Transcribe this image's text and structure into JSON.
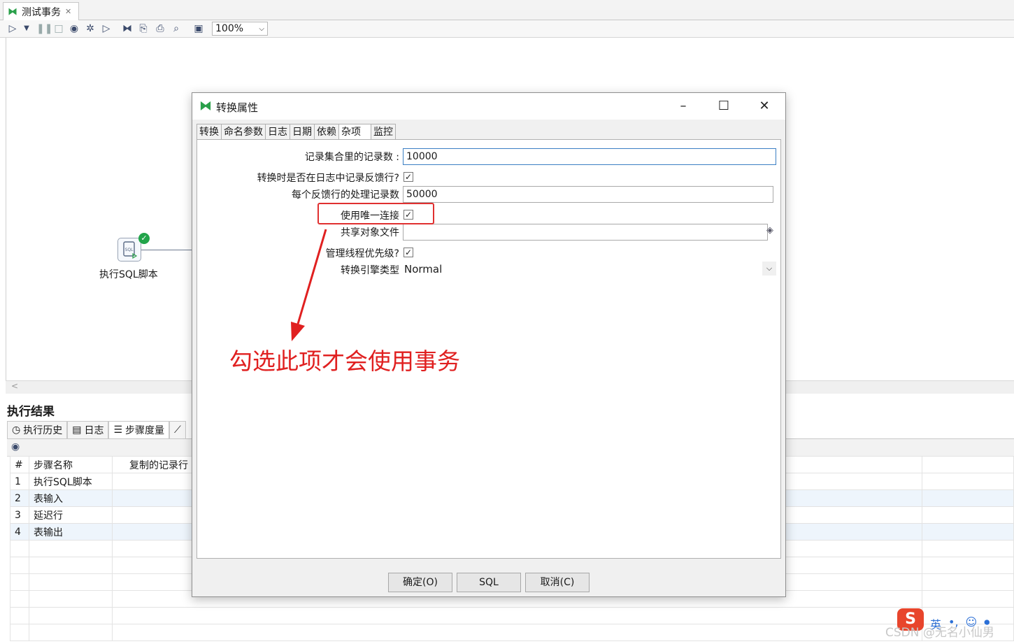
{
  "document_tab": {
    "title": "测试事务",
    "close": "✕"
  },
  "toolbar": {
    "zoom": "100%"
  },
  "canvas": {
    "step_name": "执行SQL脚本",
    "step_icon_text": "SQL"
  },
  "results": {
    "title": "执行结果",
    "tabs": [
      "执行历史",
      "日志",
      "步骤度量"
    ],
    "columns": [
      "#",
      "步骤名称",
      "复制的记录行"
    ],
    "rows": [
      {
        "num": "1",
        "name": "执行SQL脚本"
      },
      {
        "num": "2",
        "name": "表输入"
      },
      {
        "num": "3",
        "name": "延迟行"
      },
      {
        "num": "4",
        "name": "表输出"
      }
    ]
  },
  "dialog": {
    "title": "转换属性",
    "tabs": [
      "转换",
      "命名参数",
      "日志",
      "日期",
      "依赖",
      "杂项",
      "监控"
    ],
    "active_tab": "杂项",
    "fields": {
      "records_label": "记录集合里的记录数 :",
      "records_value": "10000",
      "log_feedback_label": "转换时是否在日志中记录反馈行?",
      "log_feedback_checked": true,
      "feedback_size_label": "每个反馈行的处理记录数",
      "feedback_size_value": "50000",
      "unique_conn_label": "使用唯一连接",
      "unique_conn_checked": true,
      "shared_file_label": "共享对象文件",
      "shared_file_value": "",
      "thread_priority_label": "管理线程优先级?",
      "thread_priority_checked": true,
      "engine_label": "转换引擎类型",
      "engine_value": "Normal"
    },
    "buttons": {
      "ok": "确定(O)",
      "sql": "SQL",
      "cancel": "取消(C)"
    }
  },
  "annotation": {
    "text": "勾选此项才会使用事务",
    "color": "#e02020"
  },
  "ime": {
    "logo": "S",
    "lang": "英"
  },
  "watermark": "CSDN @无名小仙男"
}
